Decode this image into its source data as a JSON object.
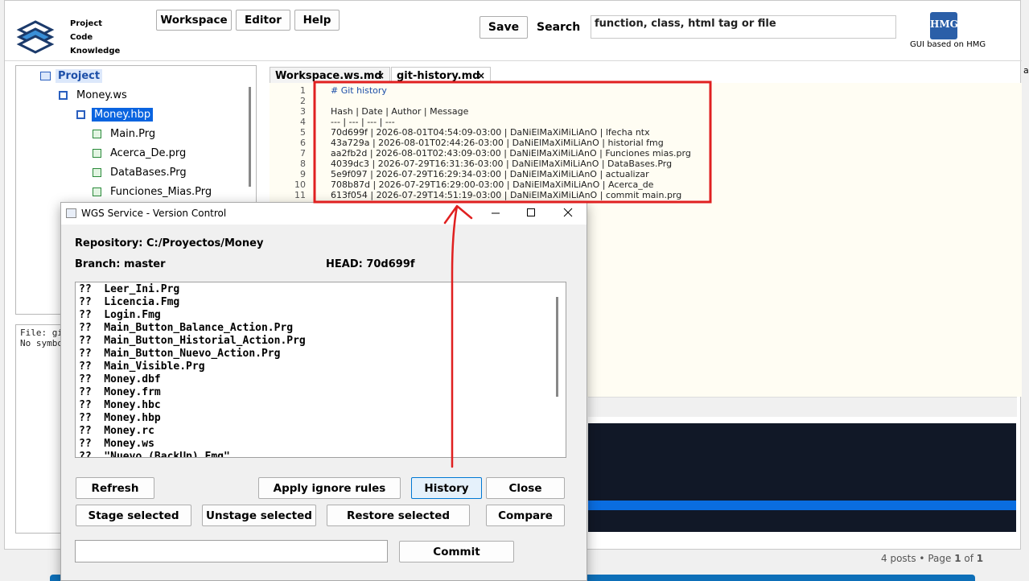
{
  "app": {
    "logo_lines": [
      "Project",
      "Code",
      "Knowledge"
    ],
    "menu": [
      "Workspace",
      "Editor",
      "Help"
    ],
    "save_label": "Save",
    "search_label": "Search",
    "search_value": "function, class, html tag or file",
    "hmg_badge": "HMG",
    "hmg_caption": "GUI based on HMG"
  },
  "tree": {
    "items": [
      {
        "label": "Project",
        "level": 0,
        "selected": false,
        "icon": "folder-icon"
      },
      {
        "label": "Money.ws",
        "level": 1,
        "selected": false,
        "icon": "workspace-icon"
      },
      {
        "label": "Money.hbp",
        "level": 2,
        "selected": true,
        "icon": "project-icon"
      },
      {
        "label": "Main.Prg",
        "level": 3,
        "selected": false,
        "icon": "prg-file-icon"
      },
      {
        "label": "Acerca_De.prg",
        "level": 3,
        "selected": false,
        "icon": "prg-file-icon"
      },
      {
        "label": "DataBases.Prg",
        "level": 3,
        "selected": false,
        "icon": "prg-file-icon"
      },
      {
        "label": "Funciones_Mias.Prg",
        "level": 3,
        "selected": false,
        "icon": "prg-file-icon"
      }
    ]
  },
  "symbols": {
    "line1": "File: gi",
    "line2": "No symbo"
  },
  "tabs": [
    {
      "label": "Workspace.ws.md",
      "close": "×",
      "active": false
    },
    {
      "label": "git-history.md",
      "close": "×",
      "active": true
    }
  ],
  "editor": {
    "lines": [
      {
        "n": "1",
        "text": "# Git history"
      },
      {
        "n": "2",
        "text": ""
      },
      {
        "n": "3",
        "text": "Hash | Date | Author | Message"
      },
      {
        "n": "4",
        "text": "--- | --- | --- | ---"
      },
      {
        "n": "5",
        "text": "70d699f | 2026-08-01T04:54:09-03:00 | DaNiElMaXiMiLiAnO | lfecha ntx"
      },
      {
        "n": "6",
        "text": "43a729a | 2026-08-01T02:44:26-03:00 | DaNiElMaXiMiLiAnO | historial fmg"
      },
      {
        "n": "7",
        "text": "aa2fb2d | 2026-08-01T02:43:09-03:00 | DaNiElMaXiMiLiAnO | Funciones mias.prg"
      },
      {
        "n": "8",
        "text": "4039dc3 | 2026-07-29T16:31:36-03:00 | DaNiElMaXiMiLiAnO | DataBases.Prg"
      },
      {
        "n": "9",
        "text": "5e9f097 | 2026-07-29T16:29:34-03:00 | DaNiElMaXiMiLiAnO | actualizar"
      },
      {
        "n": "10",
        "text": "708b87d | 2026-07-29T16:29:00-03:00 | DaNiElMaXiMiLiAnO | Acerca_de"
      },
      {
        "n": "11",
        "text": "613f054 | 2026-07-29T14:51:19-03:00 | DaNiElMaXiMiLiAnO | commit main.prg"
      }
    ]
  },
  "edge_text": "ac",
  "pagination": {
    "prefix": "4 posts • Page ",
    "page": "1",
    "of": " of ",
    "total": "1"
  },
  "dialog": {
    "title": "WGS Service - Version Control",
    "repository": "Repository: C:/Proyectos/Money",
    "branch": "Branch: master",
    "head": "HEAD: 70d699f",
    "files": [
      "??  Leer_Ini.Prg",
      "??  Licencia.Fmg",
      "??  Login.Fmg",
      "??  Main_Button_Balance_Action.Prg",
      "??  Main_Button_Historial_Action.Prg",
      "??  Main_Button_Nuevo_Action.Prg",
      "??  Main_Visible.Prg",
      "??  Money.dbf",
      "??  Money.frm",
      "??  Money.hbc",
      "??  Money.hbp",
      "??  Money.rc",
      "??  Money.ws",
      "??  \"Nuevo (BackUp).Fmg\""
    ],
    "buttons": {
      "refresh": "Refresh",
      "apply_ignore": "Apply ignore rules",
      "history": "History",
      "close": "Close",
      "stage": "Stage selected",
      "unstage": "Unstage selected",
      "restore": "Restore selected",
      "compare": "Compare",
      "commit": "Commit"
    },
    "commit_message": ""
  },
  "colors": {
    "annotation_red": "#e02020",
    "selection_blue": "#0a64e0",
    "console_bg": "#111827",
    "console_bar": "#0a6de0"
  }
}
